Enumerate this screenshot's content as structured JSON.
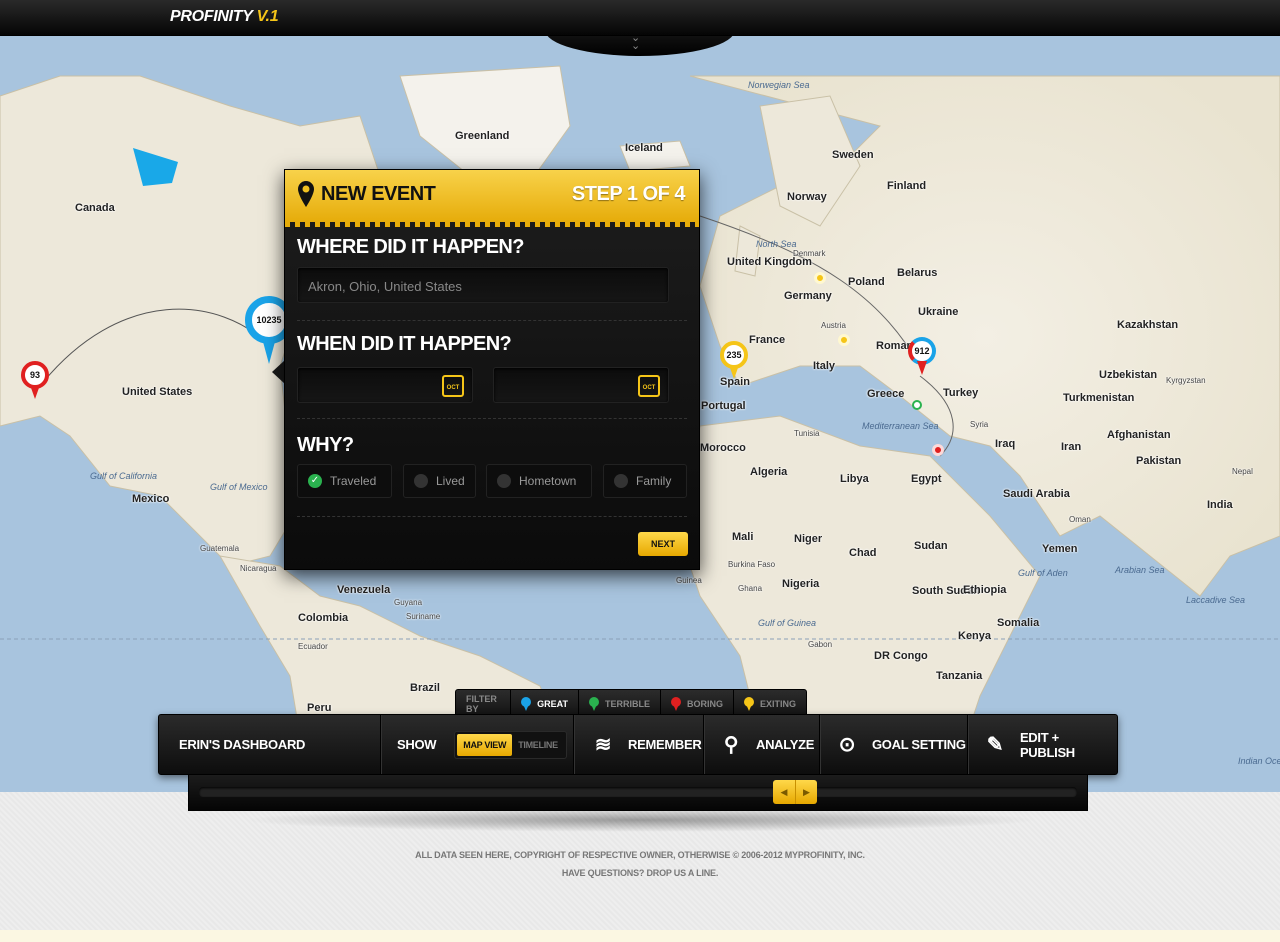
{
  "app": {
    "name": "PROFINITY",
    "version": "V.1"
  },
  "map": {
    "countries": [
      {
        "label": "Canada",
        "kind": "country"
      },
      {
        "label": "United States",
        "kind": "country"
      },
      {
        "label": "Mexico",
        "kind": "country"
      },
      {
        "label": "Guatemala",
        "kind": "small"
      },
      {
        "label": "Nicaragua",
        "kind": "small"
      },
      {
        "label": "Venezuela",
        "kind": "country"
      },
      {
        "label": "Colombia",
        "kind": "country"
      },
      {
        "label": "Guyana",
        "kind": "small"
      },
      {
        "label": "Suriname",
        "kind": "small"
      },
      {
        "label": "Ecuador",
        "kind": "small"
      },
      {
        "label": "Peru",
        "kind": "country"
      },
      {
        "label": "Brazil",
        "kind": "country"
      },
      {
        "label": "Greenland",
        "kind": "country"
      },
      {
        "label": "Iceland",
        "kind": "country"
      },
      {
        "label": "Sweden",
        "kind": "country"
      },
      {
        "label": "Finland",
        "kind": "country"
      },
      {
        "label": "Norway",
        "kind": "country"
      },
      {
        "label": "United Kingdom",
        "kind": "country"
      },
      {
        "label": "Denmark",
        "kind": "small"
      },
      {
        "label": "Germany",
        "kind": "country"
      },
      {
        "label": "Poland",
        "kind": "country"
      },
      {
        "label": "Belarus",
        "kind": "country"
      },
      {
        "label": "Ukraine",
        "kind": "country"
      },
      {
        "label": "France",
        "kind": "country"
      },
      {
        "label": "Austria",
        "kind": "small"
      },
      {
        "label": "Italy",
        "kind": "country"
      },
      {
        "label": "Romania",
        "kind": "country"
      },
      {
        "label": "Spain",
        "kind": "country"
      },
      {
        "label": "Portugal",
        "kind": "country"
      },
      {
        "label": "Greece",
        "kind": "country"
      },
      {
        "label": "Turkey",
        "kind": "country"
      },
      {
        "label": "Tunisia",
        "kind": "small"
      },
      {
        "label": "Morocco",
        "kind": "country"
      },
      {
        "label": "Algeria",
        "kind": "country"
      },
      {
        "label": "Libya",
        "kind": "country"
      },
      {
        "label": "Egypt",
        "kind": "country"
      },
      {
        "label": "Syria",
        "kind": "small"
      },
      {
        "label": "Iraq",
        "kind": "country"
      },
      {
        "label": "Iran",
        "kind": "country"
      },
      {
        "label": "Kazakhstan",
        "kind": "country"
      },
      {
        "label": "Uzbekistan",
        "kind": "country"
      },
      {
        "label": "Kyrgyzstan",
        "kind": "small"
      },
      {
        "label": "Turkmenistan",
        "kind": "country"
      },
      {
        "label": "Afghanistan",
        "kind": "country"
      },
      {
        "label": "Pakistan",
        "kind": "country"
      },
      {
        "label": "Nepal",
        "kind": "small"
      },
      {
        "label": "India",
        "kind": "country"
      },
      {
        "label": "Saudi Arabia",
        "kind": "country"
      },
      {
        "label": "Oman",
        "kind": "small"
      },
      {
        "label": "Yemen",
        "kind": "country"
      },
      {
        "label": "Mali",
        "kind": "country"
      },
      {
        "label": "Niger",
        "kind": "country"
      },
      {
        "label": "Chad",
        "kind": "country"
      },
      {
        "label": "Sudan",
        "kind": "country"
      },
      {
        "label": "South Sudan",
        "kind": "country"
      },
      {
        "label": "Ethiopia",
        "kind": "country"
      },
      {
        "label": "Somalia",
        "kind": "country"
      },
      {
        "label": "Kenya",
        "kind": "country"
      },
      {
        "label": "Nigeria",
        "kind": "country"
      },
      {
        "label": "Burkina Faso",
        "kind": "small"
      },
      {
        "label": "Ghana",
        "kind": "small"
      },
      {
        "label": "Guinea",
        "kind": "small"
      },
      {
        "label": "Gabon",
        "kind": "small"
      },
      {
        "label": "DR Congo",
        "kind": "country"
      },
      {
        "label": "Tanzania",
        "kind": "country"
      }
    ],
    "seas": [
      "Norwegian Sea",
      "North Sea",
      "Mediterranean Sea",
      "Gulf of California",
      "Gulf of Mexico",
      "Gulf of Guinea",
      "Arabian Sea",
      "Laccadive Sea",
      "Gulf of Aden",
      "Indian Ocean"
    ],
    "pins": [
      {
        "value": "93",
        "color": "#e02020"
      },
      {
        "value": "10235",
        "color": "#1aa3e8"
      },
      {
        "value": "235",
        "color": "#f5c518"
      },
      {
        "value": "912",
        "color": "#e02020"
      }
    ]
  },
  "modal": {
    "title": "NEW EVENT",
    "step": "STEP 1 OF 4",
    "where_label": "WHERE DID IT HAPPEN?",
    "where_placeholder": "Akron, Ohio, United States",
    "when_label": "WHEN DID IT HAPPEN?",
    "calendar_month": "OCT",
    "why_label": "WHY?",
    "why_options": [
      {
        "label": "Traveled",
        "selected": true
      },
      {
        "label": "Lived",
        "selected": false
      },
      {
        "label": "Hometown",
        "selected": false
      },
      {
        "label": "Family",
        "selected": false
      }
    ],
    "next_label": "NEXT"
  },
  "filter": {
    "label": "FILTER BY",
    "items": [
      {
        "label": "GREAT",
        "color": "#1aa3e8",
        "active": true
      },
      {
        "label": "TERRIBLE",
        "color": "#2ab24f",
        "active": false
      },
      {
        "label": "BORING",
        "color": "#e02020",
        "active": false
      },
      {
        "label": "EXITING",
        "color": "#f5c518",
        "active": false
      }
    ]
  },
  "dashboard": {
    "title": "ERIN'S DASHBOARD",
    "show_label": "SHOW",
    "view_options": [
      "MAP VIEW",
      "TIMELINE"
    ],
    "active_view": "MAP VIEW",
    "nav": [
      {
        "label": "REMEMBER",
        "icon": "layers-icon"
      },
      {
        "label": "ANALYZE",
        "icon": "map-marker-icon"
      },
      {
        "label": "GOAL SETTING",
        "icon": "target-icon"
      },
      {
        "label": "EDIT + PUBLISH",
        "icon": "pencil-icon"
      }
    ]
  },
  "footer": {
    "copyright": "ALL DATA SEEN HERE, COPYRIGHT OF RESPECTIVE OWNER, OTHERWISE © 2006-2012 MYPROFINITY, INC.",
    "contact": "HAVE QUESTIONS? DROP US A LINE."
  }
}
